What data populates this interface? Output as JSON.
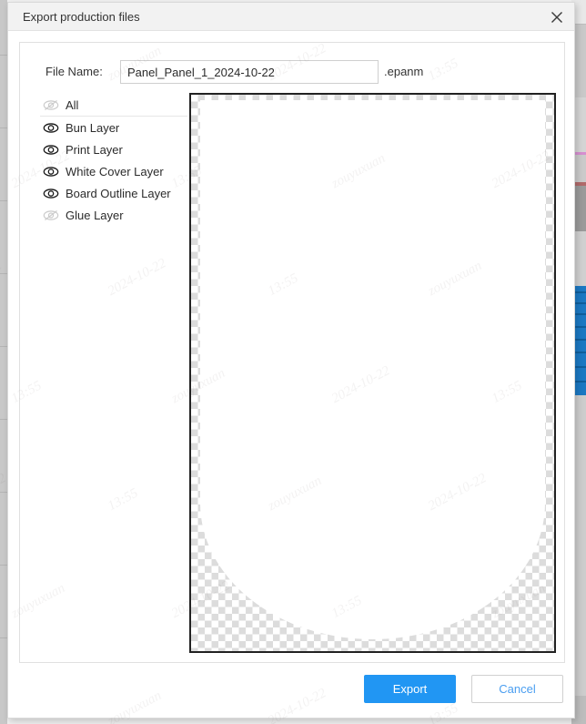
{
  "window": {
    "title": "Export production files",
    "close_icon": "close-x-icon"
  },
  "form": {
    "filename_label": "File Name:",
    "filename_value": "Panel_Panel_1_2024-10-22",
    "filename_placeholder": "Enter file name",
    "extension": ".epanm"
  },
  "layers": [
    {
      "label": "All",
      "visible": false,
      "icon": "eye-hidden-icon"
    },
    {
      "label": "Bun Layer",
      "visible": true,
      "icon": "eye-visible-icon"
    },
    {
      "label": "Print Layer",
      "visible": true,
      "icon": "eye-visible-icon"
    },
    {
      "label": "White Cover Layer",
      "visible": true,
      "icon": "eye-visible-icon"
    },
    {
      "label": "Board Outline Layer",
      "visible": true,
      "icon": "eye-visible-icon"
    },
    {
      "label": "Glue Layer",
      "visible": false,
      "icon": "eye-hidden-icon"
    }
  ],
  "preview": {
    "alt": "panel-artwork-preview",
    "transparency_checker": true
  },
  "footer": {
    "export_label": "Export",
    "cancel_label": "Cancel"
  },
  "colors": {
    "accent_blue": "#2196f3",
    "cancel_text": "#4a9ef0",
    "titlebar_bg": "#f2f2f2",
    "panel_border": "#e0e0e0",
    "preview_border": "#222222",
    "checker_gray": "#dcdcdc"
  },
  "watermarks": [
    "zouyuxuan",
    "2024-10-22",
    "13:55"
  ]
}
